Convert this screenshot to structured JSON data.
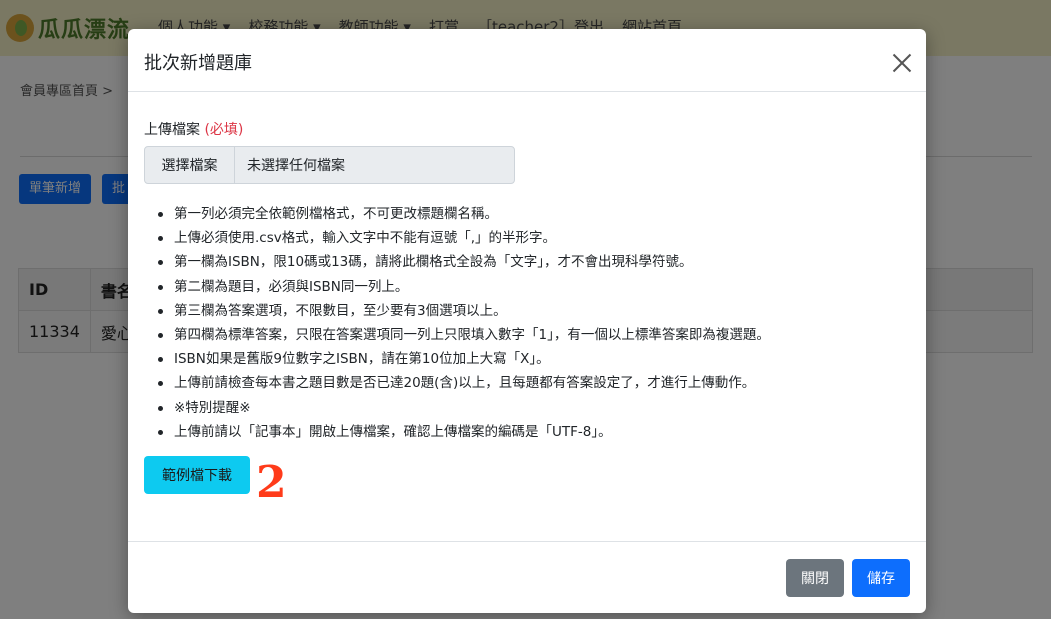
{
  "background": {
    "logo_text": "瓜瓜漂流",
    "nav_items": [
      "個人功能 ▾",
      "校務功能 ▾",
      "教師功能 ▾",
      "打賞",
      "［teacher2］登出",
      "網站首頁"
    ],
    "breadcrumb": "會員專區首頁 >",
    "buttons": [
      "單筆新增",
      "批"
    ],
    "table": {
      "headers": [
        "ID",
        "書名"
      ],
      "rows": [
        [
          "11334",
          "愛心"
        ]
      ]
    }
  },
  "modal": {
    "title": "批次新增題庫",
    "file_label": "上傳檔案",
    "required_mark": "(必填)",
    "file_button": "選擇檔案",
    "file_status": "未選擇任何檔案",
    "rules": [
      "第一列必須完全依範例檔格式，不可更改標題欄名稱。",
      "上傳必須使用.csv格式，輸入文字中不能有逗號「,」的半形字。",
      "第一欄為ISBN，限10碼或13碼，請將此欄格式全設為「文字」，才不會出現科學符號。",
      "第二欄為題目，必須與ISBN同一列上。",
      "第三欄為答案選項，不限數目，至少要有3個選項以上。",
      "第四欄為標準答案，只限在答案選項同一列上只限填入數字「1」，有一個以上標準答案即為複選題。",
      "ISBN如果是舊版9位數字之ISBN，請在第10位加上大寫「X」。",
      "上傳前請檢查每本書之題目數是否已達20題(含)以上，且每題都有答案設定了，才進行上傳動作。",
      "※特別提醒※",
      "上傳前請以「記事本」開啟上傳檔案，確認上傳檔案的編碼是「UTF-8」。"
    ],
    "download_button": "範例檔下載",
    "annotation": "2",
    "close_label": "關閉",
    "save_label": "儲存"
  },
  "colors": {
    "primary": "#0d6efd",
    "info": "#0dcaf0",
    "secondary": "#6c757d",
    "required": "#dc3545",
    "annotation": "#ff3b1a",
    "navbar": "#f4f0c6"
  }
}
